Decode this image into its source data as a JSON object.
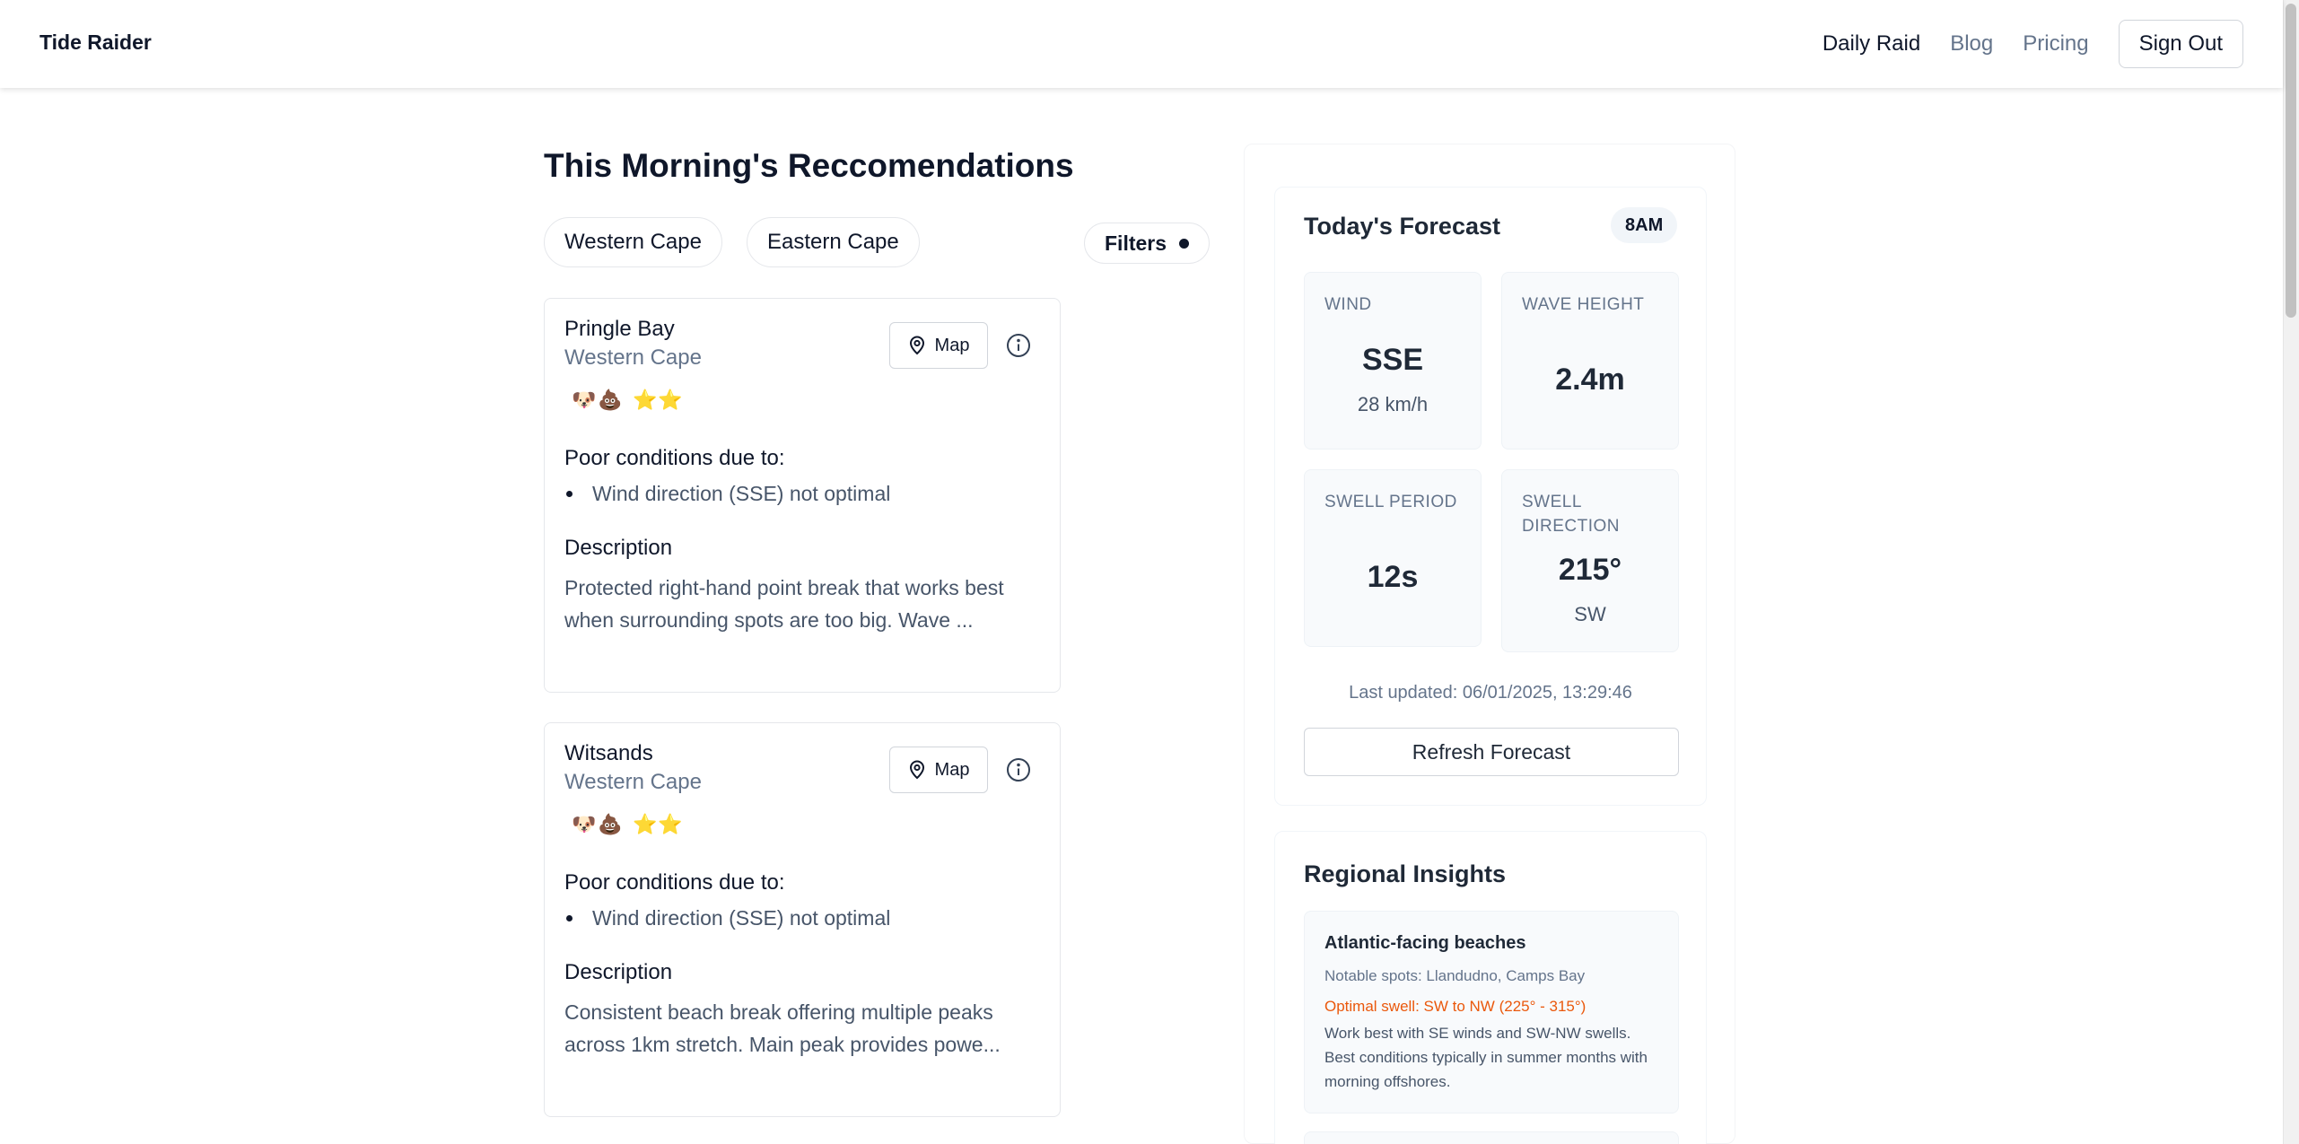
{
  "header": {
    "brand": "Tide Raider",
    "nav": [
      {
        "label": "Daily Raid",
        "active": true
      },
      {
        "label": "Blog",
        "active": false
      },
      {
        "label": "Pricing",
        "active": false
      }
    ],
    "signout_label": "Sign Out"
  },
  "main": {
    "title": "This Morning's Reccomendations",
    "region_tabs": [
      "Western Cape",
      "Eastern Cape"
    ],
    "filters_label": "Filters",
    "spots": [
      {
        "name": "Pringle Bay",
        "region": "Western Cape",
        "map_label": "Map",
        "emoji": "🐶💩",
        "stars": "⭐⭐",
        "poor_title": "Poor conditions due to:",
        "poor_reasons": [
          "Wind direction (SSE) not optimal"
        ],
        "desc_title": "Description",
        "description": "Protected right-hand point break that works best when surrounding spots are too big. Wave ..."
      },
      {
        "name": "Witsands",
        "region": "Western Cape",
        "map_label": "Map",
        "emoji": "🐶💩",
        "stars": "⭐⭐",
        "poor_title": "Poor conditions due to:",
        "poor_reasons": [
          "Wind direction (SSE) not optimal"
        ],
        "desc_title": "Description",
        "description": "Consistent beach break offering multiple peaks across 1km stretch. Main peak provides powe..."
      }
    ]
  },
  "forecast": {
    "title": "Today's Forecast",
    "time": "8AM",
    "wind": {
      "label": "WIND",
      "value": "SSE",
      "sub": "28 km/h"
    },
    "wave_height": {
      "label": "WAVE HEIGHT",
      "value": "2.4m"
    },
    "swell_period": {
      "label": "SWELL PERIOD",
      "value": "12s"
    },
    "swell_direction": {
      "label": "SWELL DIRECTION",
      "value": "215°",
      "sub": "SW"
    },
    "last_updated": "Last updated: 06/01/2025, 13:29:46",
    "refresh_label": "Refresh Forecast"
  },
  "insights": {
    "title": "Regional Insights",
    "items": [
      {
        "name": "Atlantic-facing beaches",
        "spots": "Notable spots: Llandudno, Camps Bay",
        "swell": "Optimal swell: SW to NW (225° - 315°)",
        "description": "Work best with SE winds and SW-NW swells. Best conditions typically in summer months with morning offshores."
      }
    ]
  },
  "colors": {
    "accent_text": "#0f172a",
    "muted_text": "#64748b",
    "star": "#facc15",
    "swell_highlight": "#ea580c"
  },
  "icons": [
    "map-pin-icon",
    "info-icon",
    "filter-dot-icon"
  ]
}
